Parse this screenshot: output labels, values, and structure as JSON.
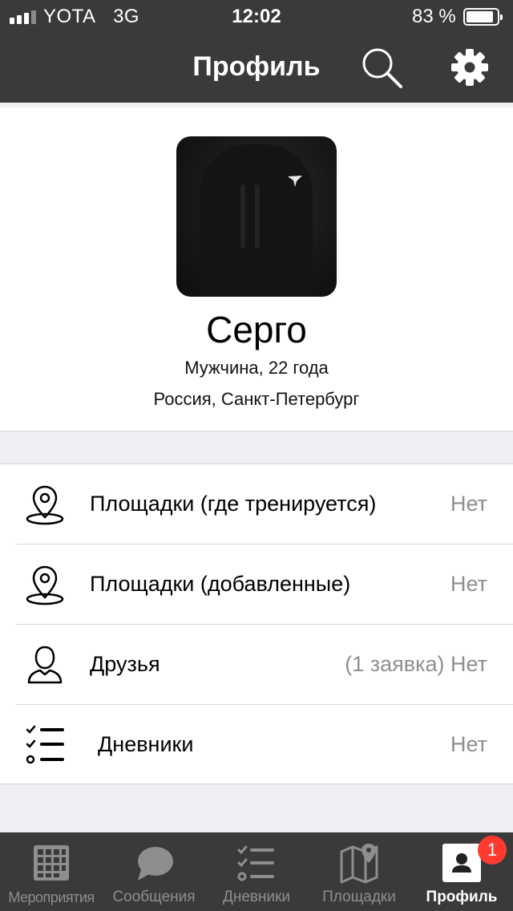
{
  "status_bar": {
    "carrier": "YOTA",
    "network": "3G",
    "time": "12:02",
    "battery_text": "83 %",
    "battery_level": 0.83
  },
  "nav": {
    "title": "Профиль",
    "search_icon": "search-icon",
    "settings_icon": "gear-icon"
  },
  "profile": {
    "name": "Серго",
    "gender_age": "Мужчина, 22 года",
    "location": "Россия, Санкт-Петербург"
  },
  "menu": {
    "items": [
      {
        "icon": "map-pin-icon",
        "label": "Площадки (где тренируется)",
        "value": "Нет"
      },
      {
        "icon": "map-pin-icon",
        "label": "Площадки (добавленные)",
        "value": "Нет"
      },
      {
        "icon": "person-icon",
        "label": "Друзья",
        "value": "(1 заявка) Нет"
      },
      {
        "icon": "checklist-icon",
        "label": "Дневники",
        "value": "Нет"
      }
    ]
  },
  "tabbar": {
    "tabs": [
      {
        "label": "Мероприятия",
        "icon": "calendar-grid-icon"
      },
      {
        "label": "Сообщения",
        "icon": "chat-bubble-icon"
      },
      {
        "label": "Дневники",
        "icon": "checklist-icon"
      },
      {
        "label": "Площадки",
        "icon": "map-icon"
      },
      {
        "label": "Профиль",
        "icon": "profile-icon",
        "active": true,
        "badge": "1"
      }
    ]
  },
  "colors": {
    "bar_background": "#3a3a3a",
    "page_background": "#efeff4",
    "secondary_text": "#8e8e93",
    "badge": "#ff3b30"
  }
}
